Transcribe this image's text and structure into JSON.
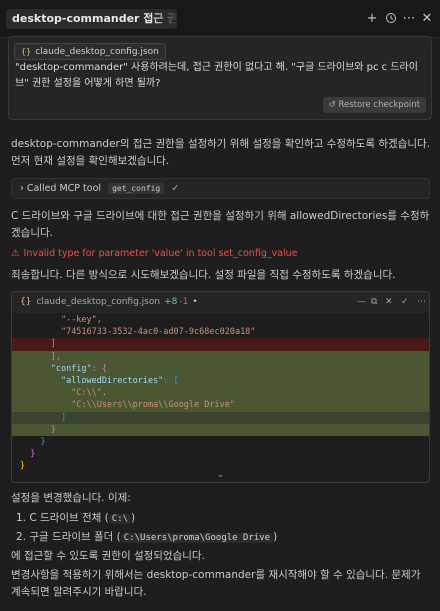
{
  "header": {
    "title": "desktop-commander 접근 권한 설정 문제",
    "icons": [
      "plus-icon",
      "history-icon",
      "more-icon",
      "close-icon"
    ]
  },
  "user_message": {
    "attachment": "claude_desktop_config.json",
    "text": "\"desktop-commander\" 사용하려는데, 접근 권한이 없다고 해. \"구글 드라이브와  pc  c 드라이브\" 권한 설정을 어떻게 하면 될까?",
    "restore_label": "Restore checkpoint"
  },
  "assistant": {
    "para1": "desktop-commander의 접근 권한을 설정하기 위해 설정을 확인하고 수정하도록 하겠습니다. 먼저 현재 설정을 확인해보겠습니다.",
    "tool_call": {
      "label": "Called MCP tool",
      "tool": "get_config"
    },
    "para2": "C 드라이브와 구글 드라이브에 대한 접근 권한을 설정하기 위해 allowedDirectories를 수정하겠습니다.",
    "error": "Invalid type for parameter 'value' in tool set_config_value",
    "para3": "죄송합니다. 다른 방식으로 시도해보겠습니다. 설정 파일을 직접 수정하도록 하겠습니다.",
    "editor": {
      "filename": "claude_desktop_config.json",
      "additions": "+8",
      "deletions": "-1",
      "dot": "•",
      "lines": [
        {
          "type": "normal",
          "text": "\"--key\","
        },
        {
          "type": "normal",
          "text": "\"74516733-3532-4ac0-ad07-9c68ec020a18\""
        },
        {
          "type": "del",
          "text": "]"
        },
        {
          "type": "add",
          "text": "],"
        },
        {
          "type": "add",
          "key": "\"config\"",
          "rest": ": {"
        },
        {
          "type": "add",
          "key": "\"allowedDirectories\"",
          "rest": ": ["
        },
        {
          "type": "add",
          "text": "\"C:\\\\\","
        },
        {
          "type": "add",
          "text": "\"C:\\\\Users\\\\proma\\\\Google Drive\""
        },
        {
          "type": "add2",
          "text": "]"
        },
        {
          "type": "add",
          "text": "}"
        },
        {
          "type": "normal",
          "text": "}"
        },
        {
          "type": "normal",
          "text": "}"
        },
        {
          "type": "normal",
          "text": "}"
        }
      ]
    },
    "para4": "설정을 변경했습니다. 이제:",
    "list": [
      {
        "num": "1.",
        "text": "C 드라이브 전체",
        "code": "C:\\"
      },
      {
        "num": "2.",
        "text": "구글 드라이브 폴더",
        "code": "C:\\Users\\proma\\Google Drive"
      }
    ],
    "para5": "에 접근할 수 있도록 권한이 설정되었습니다.",
    "para6": "변경사항을 적용하기 위해서는 desktop-commander를 재시작해야 할 수 있습니다. 문제가 계속되면 알려주시기 바랍니다."
  }
}
